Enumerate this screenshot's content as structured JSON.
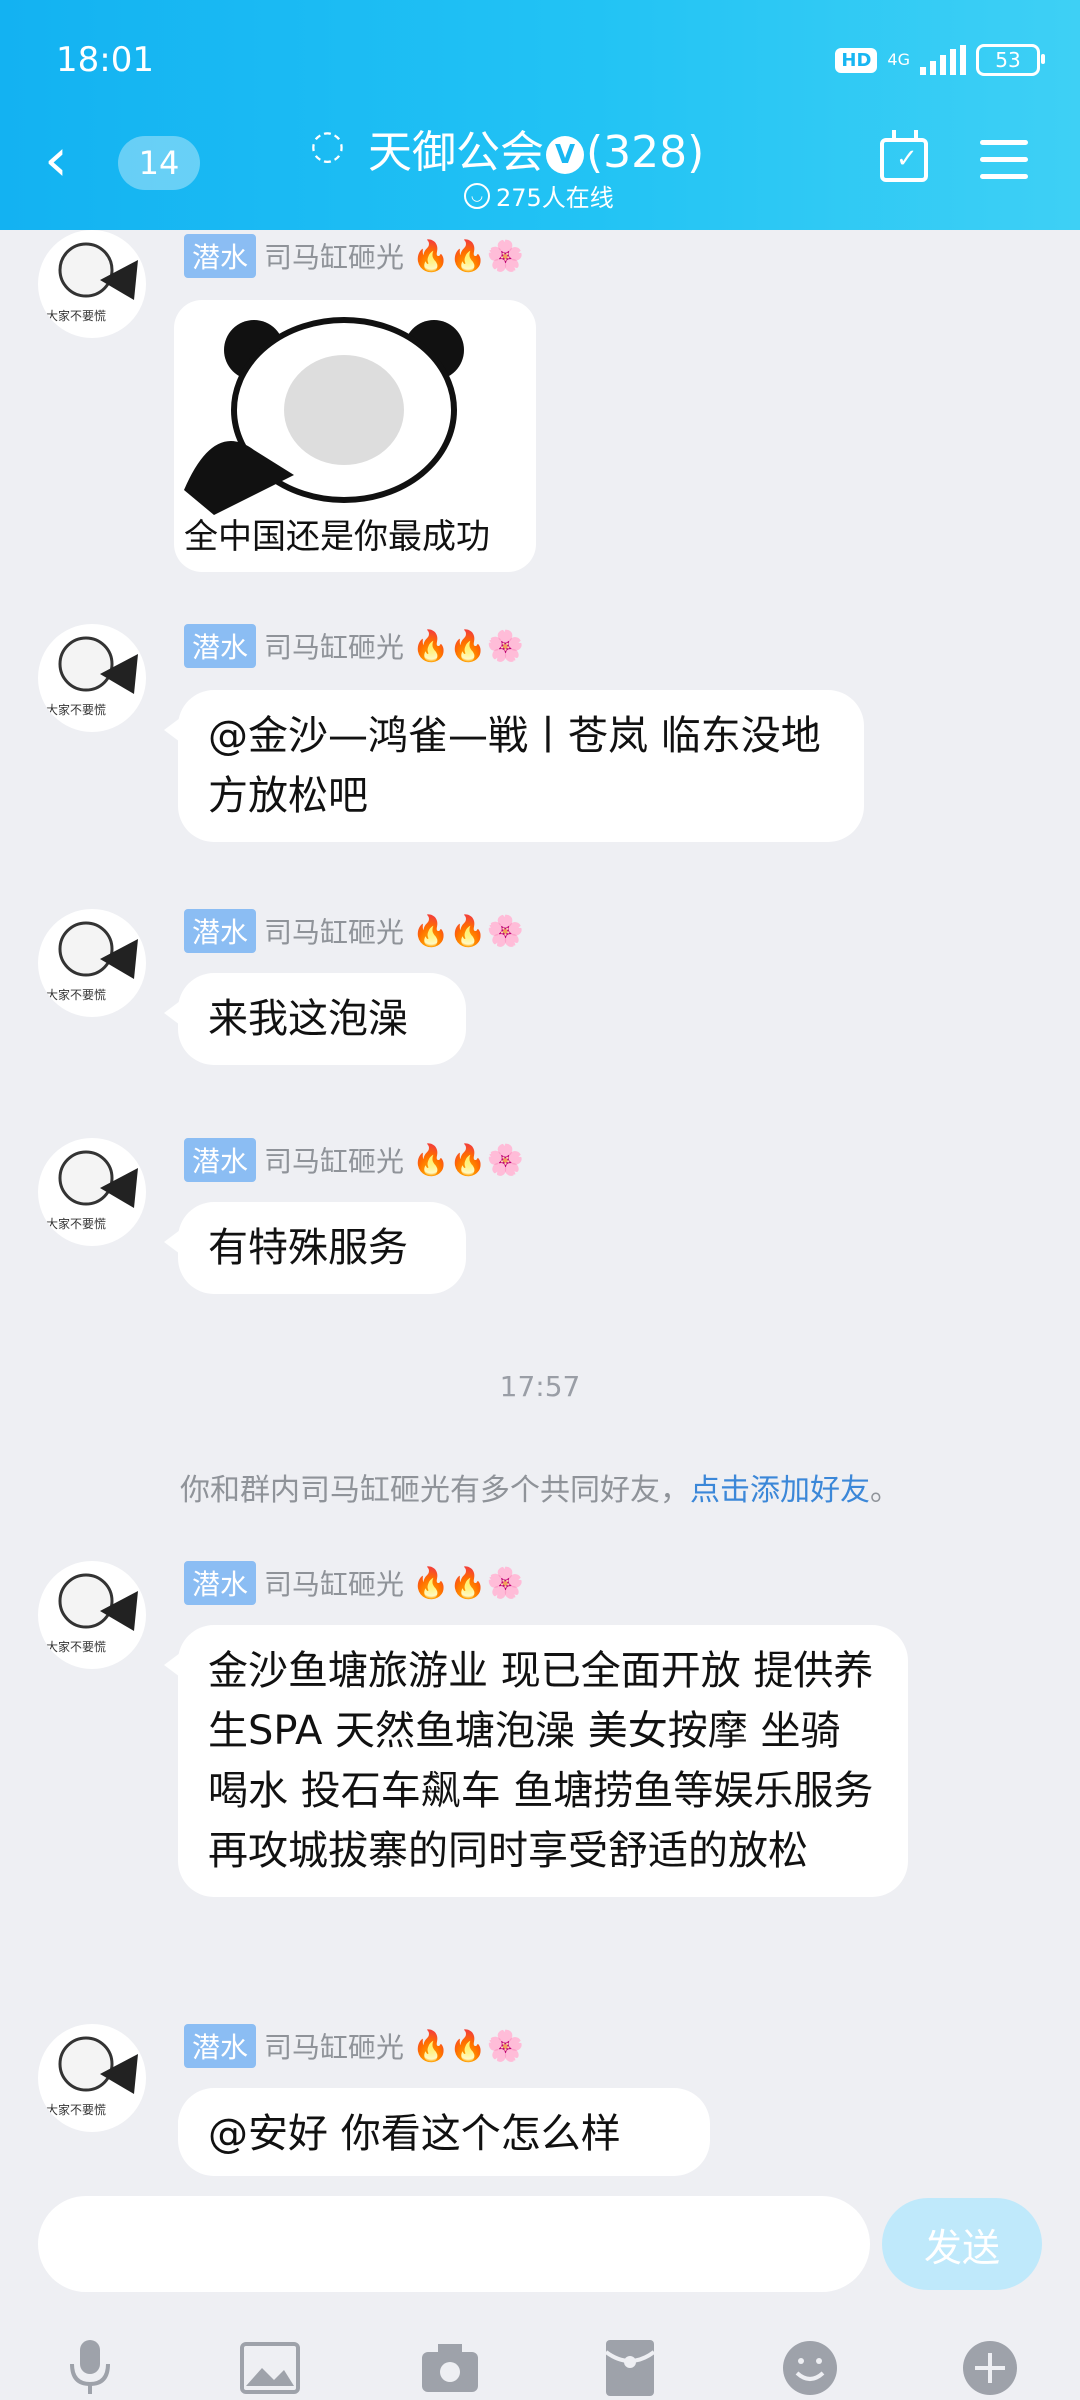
{
  "status_bar": {
    "time": "18:01",
    "hd": "HD",
    "network": "4G",
    "battery": "53"
  },
  "header": {
    "unread_count": "14",
    "group_name": "天御公会",
    "verified": "V",
    "member_count": "(328)",
    "online_text": "275人在线"
  },
  "sender": {
    "role": "潜水",
    "name": "司马缸砸光",
    "badges": "🔥🔥🌸"
  },
  "messages": [
    {
      "type": "image",
      "caption": "全中国还是你最成功"
    },
    {
      "type": "text",
      "text": "@金沙—鸿雀—戦丨苍岚 临东没地方放松吧"
    },
    {
      "type": "text",
      "text": "来我这泡澡"
    },
    {
      "type": "text",
      "text": "有特殊服务"
    },
    {
      "type": "text",
      "text": "金沙鱼塘旅游业 现已全面开放 提供养生SPA 天然鱼塘泡澡 美女按摩 坐骑喝水 投石车飙车  鱼塘捞鱼等娱乐服务 再攻城拔寨的同时享受舒适的放松"
    },
    {
      "type": "text",
      "text": "@安好 你看这个怎么样"
    }
  ],
  "timestamp": "17:57",
  "system_note": {
    "text": "你和群内司马缸砸光有多个共同好友，",
    "link": "点击添加好友",
    "end": "。"
  },
  "input": {
    "placeholder": "",
    "send_label": "发送"
  },
  "toolbar": [
    "mic-icon",
    "image-icon",
    "camera-icon",
    "redpacket-icon",
    "emoji-icon",
    "plus-icon"
  ],
  "colors": {
    "header_start": "#13b2f2",
    "header_end": "#3ed0f5",
    "role_tag": "#8bbdf3",
    "link": "#3b87d8",
    "background": "#eeeff3"
  }
}
